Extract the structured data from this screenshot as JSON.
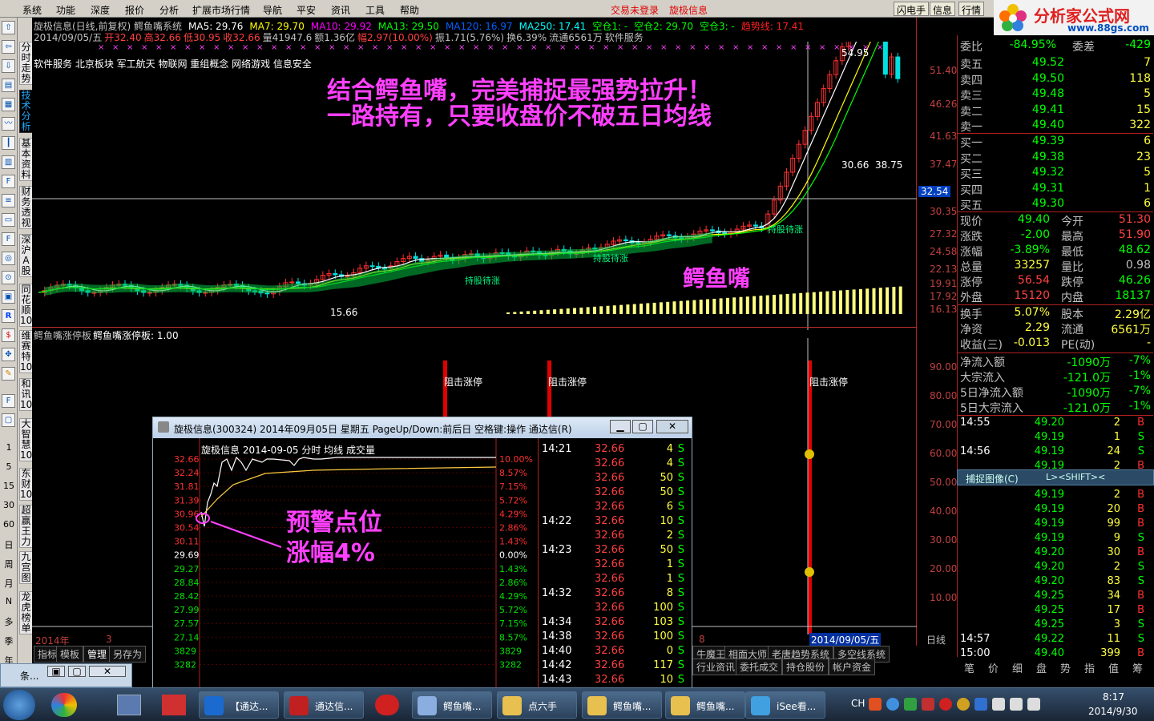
{
  "menu": {
    "items": [
      "系统",
      "功能",
      "深度",
      "报价",
      "分析",
      "扩展市场行情",
      "导航",
      "平安",
      "资讯",
      "工具",
      "帮助"
    ],
    "status": "交易未登录",
    "stock": "旋极信息",
    "buttons": [
      "闪电手",
      "信息",
      "行情"
    ]
  },
  "logo": {
    "name": "分析家公式网",
    "url": "www.88gs.com"
  },
  "left_tabs": [
    "分时走势",
    "技术分析",
    "基本资料",
    "财务透视",
    "深沪A股",
    "同花顺10",
    "维赛特10",
    "和讯10",
    "大智慧10",
    "东财10",
    "超赢王力",
    "九宫图",
    "龙虎榜单"
  ],
  "left_periods": [
    "1",
    "5",
    "15",
    "30",
    "60",
    "日",
    "周",
    "月",
    "N",
    "多",
    "季",
    "年"
  ],
  "chart": {
    "header1": "旋极信息(日线,前复权) 鳄鱼嘴系统",
    "ma": [
      {
        "label": "MA5: 29.76",
        "color": "#ffffff"
      },
      {
        "label": "MA7: 29.70",
        "color": "#ffff00"
      },
      {
        "label": "MA10: 29.92",
        "color": "#ff00ff"
      },
      {
        "label": "MA13: 29.50",
        "color": "#00ff00"
      },
      {
        "label": "MA120: 16.97",
        "color": "#0060ff"
      },
      {
        "label": "MA250: 17.41",
        "color": "#00ffff"
      },
      {
        "label": "空仓1: -",
        "color": "#00ff00"
      },
      {
        "label": "空仓2: 29.70",
        "color": "#00ff00"
      },
      {
        "label": "空仓3: -",
        "color": "#00ff00"
      },
      {
        "label": "趋势线: 17.41",
        "color": "#ff2020"
      }
    ],
    "ohlc": [
      {
        "t": "2014/09/05/五",
        "c": "#c0c0c0"
      },
      {
        "t": "开32.40",
        "c": "#ff4040"
      },
      {
        "t": "高32.66",
        "c": "#ff4040"
      },
      {
        "t": "低30.95",
        "c": "#ff4040"
      },
      {
        "t": "收32.66",
        "c": "#ff4040"
      },
      {
        "t": "量41947.6",
        "c": "#c0c0c0"
      },
      {
        "t": "额1.36亿",
        "c": "#c0c0c0"
      },
      {
        "t": "幅2.97(10.00%)",
        "c": "#ff4040"
      },
      {
        "t": "振1.71(5.76%)",
        "c": "#c0c0c0"
      },
      {
        "t": "换6.39%",
        "c": "#c0c0c0"
      },
      {
        "t": "流通6561万",
        "c": "#c0c0c0"
      },
      {
        "t": "软件服务",
        "c": "#c0c0c0"
      }
    ],
    "sectors": "软件服务 北京板块 军工航天 物联网 重组概念 网络游戏 信息安全",
    "headline1": "结合鳄鱼嘴，完美捕捉最强势拉升！",
    "headline2": "一路持有，只要收盘价不破五日均线",
    "croc_label": "鳄鱼嘴",
    "small_labels": [
      "持股待涨",
      "持股待涨",
      "持股待涨"
    ],
    "peak": "54.95",
    "low": "15.66",
    "val1": "30.66",
    "val2": "38.75",
    "yticks": [
      "51.40",
      "46.26",
      "41.63",
      "37.47",
      "30.35",
      "27.32",
      "24.58",
      "22.13",
      "19.91",
      "17.92",
      "16.13"
    ],
    "cursor_price": "32.54",
    "sub_header": [
      "鳄鱼嘴涨停板",
      "鳄鱼嘴涨停板: 1.00"
    ],
    "sub_labels": [
      "阻击涨停",
      "阻击涨停",
      "阻击涨停"
    ],
    "sub_yticks": [
      "90.00",
      "80.00",
      "70.00",
      "60.00",
      "50.00",
      "40.00",
      "30.00",
      "20.00",
      "10.00"
    ],
    "date_left": "2014年",
    "date_mark": "3",
    "date_mark2": "8",
    "cursor_date": "2014/09/05/五",
    "daily": "日线"
  },
  "bottom_tabs": [
    "指标",
    "模板",
    "管理",
    "另存为",
    "牛魔王",
    "相面大师",
    "老唐趋势系统",
    "多空线系统",
    "行业资讯",
    "委托成交",
    "持仓股份",
    "帐户资金"
  ],
  "popup": {
    "title": "旋极信息(300324) 2014年09月05日 星期五 PageUp/Down:前后日 空格键:操作 通达信(R)",
    "chart_header": "旋极信息    2014-09-05 分时 均线 成交量",
    "warning": "预警点位",
    "warning2": "涨幅4%",
    "prices": [
      "32.66",
      "32.24",
      "31.81",
      "31.39",
      "30.96",
      "30.54",
      "30.11",
      "29.69",
      "29.27",
      "28.84",
      "28.42",
      "27.99",
      "27.57",
      "27.14",
      "3829",
      "3282"
    ],
    "pcts": [
      "10.00%",
      "8.57%",
      "7.15%",
      "5.72%",
      "4.29%",
      "2.86%",
      "1.43%",
      "0.00%",
      "1.43%",
      "2.86%",
      "4.29%",
      "5.72%",
      "7.15%",
      "8.57%",
      "3829",
      "3282"
    ],
    "ticks": [
      [
        "14:21",
        "32.66",
        "4",
        "S"
      ],
      [
        "",
        "32.66",
        "4",
        "S"
      ],
      [
        "",
        "32.66",
        "50",
        "S"
      ],
      [
        "",
        "32.66",
        "50",
        "S"
      ],
      [
        "",
        "32.66",
        "6",
        "S"
      ],
      [
        "14:22",
        "32.66",
        "10",
        "S"
      ],
      [
        "",
        "32.66",
        "2",
        "S"
      ],
      [
        "14:23",
        "32.66",
        "50",
        "S"
      ],
      [
        "",
        "32.66",
        "1",
        "S"
      ],
      [
        "",
        "32.66",
        "1",
        "S"
      ],
      [
        "14:32",
        "32.66",
        "8",
        "S"
      ],
      [
        "",
        "32.66",
        "100",
        "S"
      ],
      [
        "14:34",
        "32.66",
        "103",
        "S"
      ],
      [
        "14:38",
        "32.66",
        "100",
        "S"
      ],
      [
        "14:40",
        "32.66",
        "0",
        "S"
      ],
      [
        "14:42",
        "32.66",
        "117",
        "S"
      ],
      [
        "14:43",
        "32.66",
        "10",
        "S"
      ]
    ]
  },
  "quote": {
    "weibi": {
      "label": "委比",
      "val": "-84.95%",
      "label2": "委差",
      "val2": "-429"
    },
    "asks": [
      {
        "l": "卖五",
        "p": "49.52",
        "v": "7"
      },
      {
        "l": "卖四",
        "p": "49.50",
        "v": "118"
      },
      {
        "l": "卖三",
        "p": "49.48",
        "v": "5"
      },
      {
        "l": "卖二",
        "p": "49.41",
        "v": "15"
      },
      {
        "l": "卖一",
        "p": "49.40",
        "v": "322"
      }
    ],
    "bids": [
      {
        "l": "买一",
        "p": "49.39",
        "v": "6"
      },
      {
        "l": "买二",
        "p": "49.38",
        "v": "23"
      },
      {
        "l": "买三",
        "p": "49.32",
        "v": "5"
      },
      {
        "l": "买四",
        "p": "49.31",
        "v": "1"
      },
      {
        "l": "买五",
        "p": "49.30",
        "v": "6"
      }
    ],
    "stats": [
      [
        "现价",
        "49.40",
        "今开",
        "51.30"
      ],
      [
        "涨跌",
        "-2.00",
        "最高",
        "51.90"
      ],
      [
        "涨幅",
        "-3.89%",
        "最低",
        "48.62"
      ],
      [
        "总量",
        "33257",
        "量比",
        "0.98"
      ],
      [
        "涨停",
        "56.54",
        "跌停",
        "46.26"
      ],
      [
        "外盘",
        "15120",
        "内盘",
        "18137"
      ]
    ],
    "stats2": [
      [
        "换手",
        "5.07%",
        "股本",
        "2.29亿"
      ],
      [
        "净资",
        "2.29",
        "流通",
        "6561万"
      ],
      [
        "收益(三)",
        "-0.013",
        "PE(动)",
        "-"
      ]
    ],
    "flows": [
      [
        "净流入额",
        "-1090万",
        "-7%"
      ],
      [
        "大宗流入",
        "-121.0万",
        "-1%"
      ],
      [
        "5日净流入额",
        "-1090万",
        "-7%"
      ],
      [
        "5日大宗流入",
        "-121.0万",
        "-1%"
      ]
    ],
    "trades": [
      [
        "14:55",
        "49.20",
        "2",
        "B"
      ],
      [
        "",
        "49.19",
        "1",
        "S"
      ],
      [
        "14:56",
        "49.19",
        "24",
        "S"
      ],
      [
        "",
        "49.19",
        "2",
        "B"
      ],
      [
        "",
        "49.19",
        "19",
        "B"
      ],
      [
        "",
        "49.19",
        "2",
        "B"
      ],
      [
        "",
        "49.19",
        "20",
        "B"
      ],
      [
        "",
        "49.19",
        "99",
        "B"
      ],
      [
        "",
        "49.19",
        "9",
        "S"
      ],
      [
        "",
        "49.20",
        "30",
        "B"
      ],
      [
        "",
        "49.20",
        "2",
        "S"
      ],
      [
        "",
        "49.20",
        "83",
        "S"
      ],
      [
        "",
        "49.25",
        "34",
        "B"
      ],
      [
        "",
        "49.25",
        "17",
        "B"
      ],
      [
        "",
        "49.25",
        "3",
        "S"
      ],
      [
        "14:57",
        "49.22",
        "11",
        "S"
      ],
      [
        "15:00",
        "49.40",
        "399",
        "B"
      ]
    ],
    "bottom_tabs": [
      "笔",
      "价",
      "细",
      "盘",
      "势",
      "指",
      "值",
      "筹"
    ],
    "capture": "捕捉图像(C)",
    "capture_hint": "L><SHIFT><"
  },
  "taskbar": {
    "items": [
      "【通达...",
      "通达信...",
      "",
      "鳄鱼嘴...",
      "点六手",
      "鳄鱼嘴...",
      "鳄鱼嘴...",
      "iSee看..."
    ],
    "time": "8:17",
    "date": "2014/9/30",
    "lang": "CH",
    "mini_window": "条..."
  }
}
